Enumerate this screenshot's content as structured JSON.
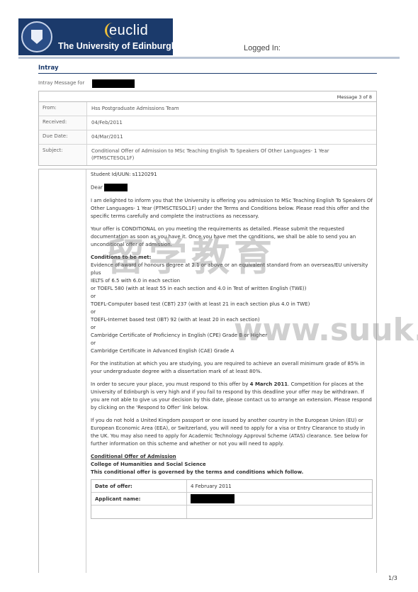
{
  "header": {
    "brand": "euclid",
    "university": "The University of Edinburgh",
    "logged_in_label": "Logged In:"
  },
  "intray": {
    "title": "Intray",
    "message_for_label": "Intray Message for",
    "message_count": "Message 3 of 8"
  },
  "details": [
    {
      "label": "From:",
      "value": "Hss Postgraduate Admissions Team"
    },
    {
      "label": "Received:",
      "value": "04/Feb/2011"
    },
    {
      "label": "Due Date:",
      "value": "04/Mar/2011"
    },
    {
      "label": "Subject:",
      "value": "Conditional Offer of Admission to MSc Teaching English To Speakers Of Other Languages- 1 Year (PTMSCTESOL1F)"
    }
  ],
  "letter": {
    "student_id": "Student Id/UUN: s1120291",
    "dear": "Dear",
    "p1": "I am delighted to inform you that the University is offering you admission to MSc Teaching English To Speakers Of Other Languages- 1 Year (PTMSCTESOL1F) under the Terms and Conditions below. Please read this offer and the specific terms carefully and complete the instructions as necessary.",
    "p2": "Your offer is CONDITIONAL on you meeting the requirements as detailed. Please submit the requested documentation as soon as you have it. Once you have met the conditions, we shall be able to send you an unconditional offer of admission.",
    "conditions_heading": "Conditions to be met:",
    "conditions": [
      "Evidence of award of honours degree at 2.1 or above or an equivalent standard from an overseas/EU university",
      "plus",
      "IELTS of 6.5 with 6.0 in each section",
      "or TOEFL 580 (with at least 55 in each section and 4.0 in Test of written English (TWE))",
      "or",
      "TOEFL-Computer based test (CBT) 237 (with at least 21 in each section plus 4.0 in TWE)",
      "or",
      "TOEFL-Internet based test (IBT) 92 (with at least 20 in each section)",
      "or",
      "Cambridge Certificate of Proficiency in English (CPE) Grade B or Higher",
      "or",
      "Cambridge Certificate in Advanced English (CAE) Grade A"
    ],
    "p3": "For the institution at which you are studying, you are required to achieve an overall minimum grade of 85% in your undergraduate degree with a dissertation mark of at least 80%.",
    "p4_a": "In order to secure your place, you must respond to this offer by ",
    "p4_date": "4 March 2011",
    "p4_b": ". Competition for places at the University of Edinburgh is very high and if you fail to respond by this deadline your offer may be withdrawn. If you are not able to give us your decision by this date, please contact us to arrange an extension. Please respond by clicking on the 'Respond to Offer' link below.",
    "p5": "If you do not hold a United Kingdom passport or one issued by another country in the European Union (EU) or European Economic Area (EEA), or Switzerland, you will need to apply for a visa or Entry Clearance to study in the UK. You may also need to apply for Academic Technology Approval Scheme (ATAS) clearance. See below for further information on this scheme and whether or not you will need to apply.",
    "offer_heading": "Conditional Offer of Admission",
    "college": "College of Humanities and Social Science",
    "governed": "This conditional offer is governed by the terms and conditions which follow.",
    "offer_rows": [
      {
        "label": "Date of offer:",
        "value": "4 February 2011"
      },
      {
        "label": "Applicant name:",
        "value": ""
      },
      {
        "label": "",
        "value": ""
      }
    ]
  },
  "watermark": {
    "text_cn": "留学教育",
    "url": "www.suuk.org"
  },
  "page_number": "1/3"
}
